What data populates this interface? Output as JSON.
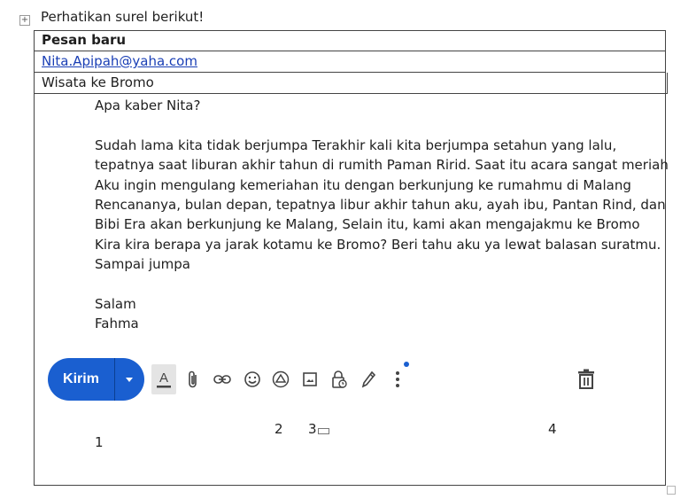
{
  "intro_text": "Perhatikan surel berikut!",
  "email": {
    "heading": "Pesan baru",
    "to": "Nita.Apipah@yaha.com",
    "subject": "Wisata ke Bromo",
    "body_lines": [
      "Apa kaber  Nita?",
      "",
      "Sudah lama kita tidak berjumpa Terakhir kali kita berjumpa setahun yang lalu,",
      "tepatnya saat liburan akhir tahun di rumith Paman Ririd. Saat itu acara sangat meriah",
      "Aku ingin mengulang kemeriahan itu dengan berkunjung ke rumahmu di Malang",
      "Rencananya, bulan depan, tepatnya libur akhir tahun aku, ayah ibu, Pantan Rind, dan",
      "Bibi Era akan berkunjung ke Malang, Selain itu, kami akan mengajakmu ke Bromo",
      "Kira kira berapa ya jarak kotamu ke Bromo? Beri tahu aku ya lewat balasan suratmu.",
      "Sampai jumpa",
      "",
      "Salam",
      "Fahma"
    ]
  },
  "toolbar": {
    "send_label": "Kirim",
    "icons": [
      "format-text-icon",
      "attach-icon",
      "link-icon",
      "emoji-icon",
      "drive-icon",
      "photo-icon",
      "lock-clock-icon",
      "pen-icon",
      "more-vert-icon",
      "trash-icon"
    ],
    "accent_color": "#1a5fd0"
  },
  "labels": {
    "n1": "1",
    "n2": "2",
    "n3": "3",
    "n4": "4"
  }
}
